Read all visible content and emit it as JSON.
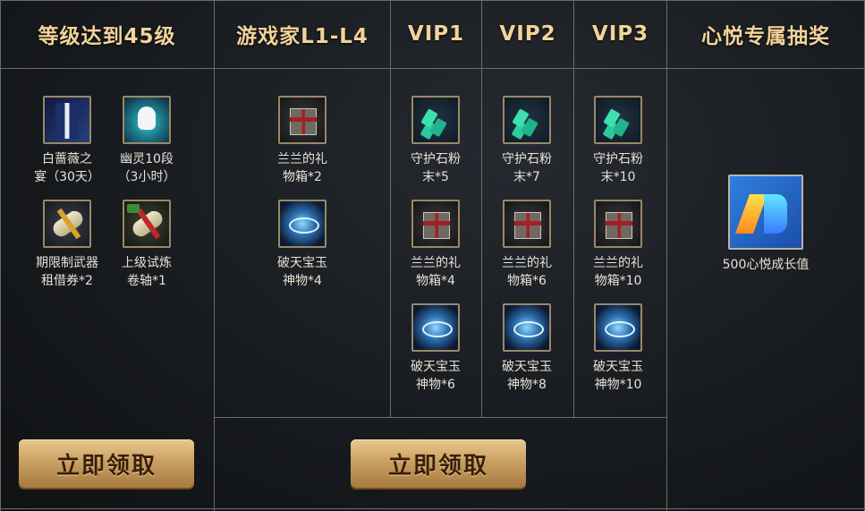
{
  "headers": [
    "等级达到45级",
    "游戏家L1-L4",
    "VIP1",
    "VIP2",
    "VIP3",
    "心悦专属抽奖"
  ],
  "level45": {
    "items": [
      {
        "icon": "suit-icon",
        "caption": "白蔷薇之\n宴（30天）"
      },
      {
        "icon": "ghost-pet-icon",
        "caption": "幽灵10段\n（3小时）"
      },
      {
        "icon": "scroll-icon",
        "caption": "期限制武器\n租借券*2"
      },
      {
        "icon": "scroll-icon",
        "caption": "上级试炼\n卷轴*1"
      }
    ],
    "button": "立即领取"
  },
  "gamer": {
    "items": [
      {
        "icon": "gift-box-icon",
        "caption": "兰兰的礼\n物箱*2"
      },
      {
        "icon": "jade-orb-icon",
        "caption": "破天宝玉\n神物*4"
      }
    ]
  },
  "vip1": {
    "items": [
      {
        "icon": "crystal-icon",
        "caption": "守护石粉\n末*5"
      },
      {
        "icon": "gift-box-icon",
        "caption": "兰兰的礼\n物箱*4"
      },
      {
        "icon": "jade-orb-icon",
        "caption": "破天宝玉\n神物*6"
      }
    ]
  },
  "vip2": {
    "items": [
      {
        "icon": "crystal-icon",
        "caption": "守护石粉\n末*7"
      },
      {
        "icon": "gift-box-icon",
        "caption": "兰兰的礼\n物箱*6"
      },
      {
        "icon": "jade-orb-icon",
        "caption": "破天宝玉\n神物*8"
      }
    ]
  },
  "vip3": {
    "items": [
      {
        "icon": "crystal-icon",
        "caption": "守护石粉\n末*10"
      },
      {
        "icon": "gift-box-icon",
        "caption": "兰兰的礼\n物箱*10"
      },
      {
        "icon": "jade-orb-icon",
        "caption": "破天宝玉\n神物*10"
      }
    ]
  },
  "xinyue": {
    "items": [
      {
        "icon": "vip-logo-icon",
        "caption": "500心悦成长值"
      }
    ]
  },
  "vip_button": "立即领取",
  "colors": {
    "header_text": "#f2d39a",
    "button_gold": "#caa063",
    "grid": "#6b6b6b"
  }
}
